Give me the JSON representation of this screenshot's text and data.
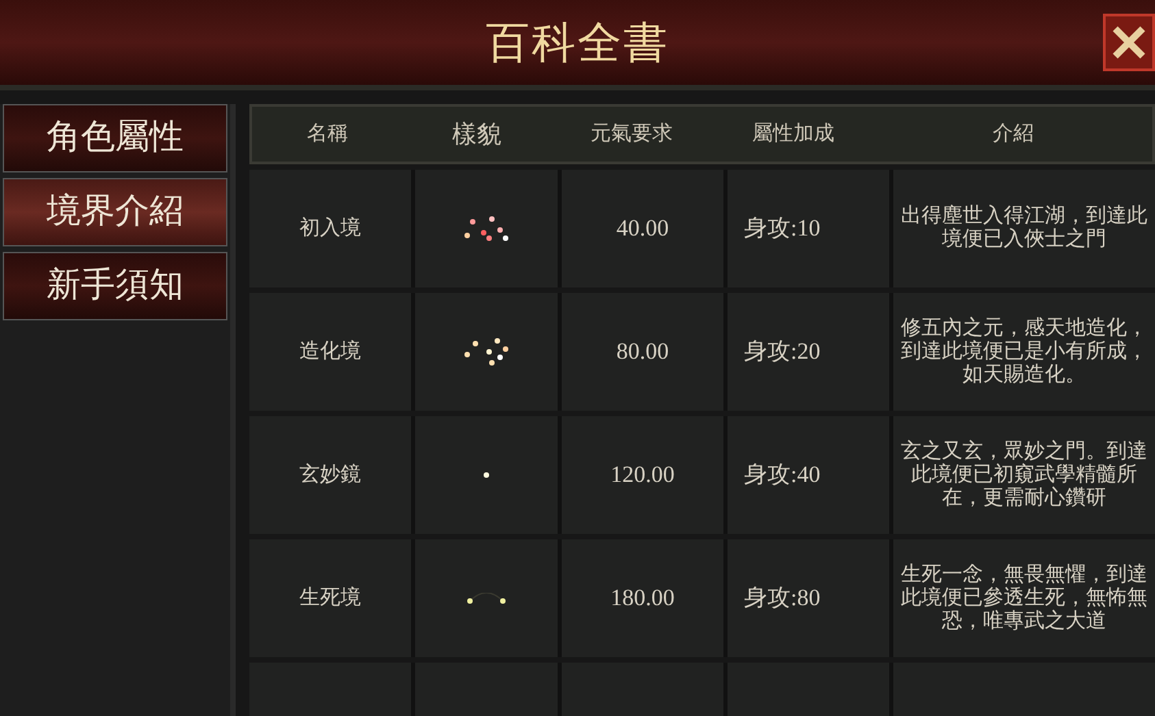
{
  "window": {
    "title": "百科全書"
  },
  "sidebar": {
    "items": [
      {
        "label": "角色屬性",
        "selected": false
      },
      {
        "label": "境界介紹",
        "selected": true
      },
      {
        "label": "新手須知",
        "selected": false
      }
    ]
  },
  "table": {
    "columns": [
      "名稱",
      "樣貌",
      "元氣要求",
      "屬性加成",
      "介紹"
    ],
    "rows": [
      {
        "name": "初入境",
        "kind": "cluster",
        "requirement": "40.00",
        "bonus": "身攻:10",
        "description": [
          "出得塵世入得江湖，到達此",
          "境便已入俠士之門"
        ]
      },
      {
        "name": "造化境",
        "kind": "burst",
        "requirement": "80.00",
        "bonus": "身攻:20",
        "description": [
          "修五內之元，感天地造化，",
          "到達此境便已是小有所成，",
          "如天賜造化。"
        ]
      },
      {
        "name": "玄妙鏡",
        "kind": "single",
        "requirement": "120.00",
        "bonus": "身攻:40",
        "description": [
          "玄之又玄，眾妙之門。到達",
          "此境便已初窺武學精髓所",
          "在，更需耐心鑽研"
        ]
      },
      {
        "name": "生死境",
        "kind": "pair",
        "requirement": "180.00",
        "bonus": "身攻:80",
        "description": [
          "生死一念，無畏無懼，到達",
          "此境便已參透生死，無怖無",
          "恐，唯專武之大道"
        ]
      }
    ]
  }
}
